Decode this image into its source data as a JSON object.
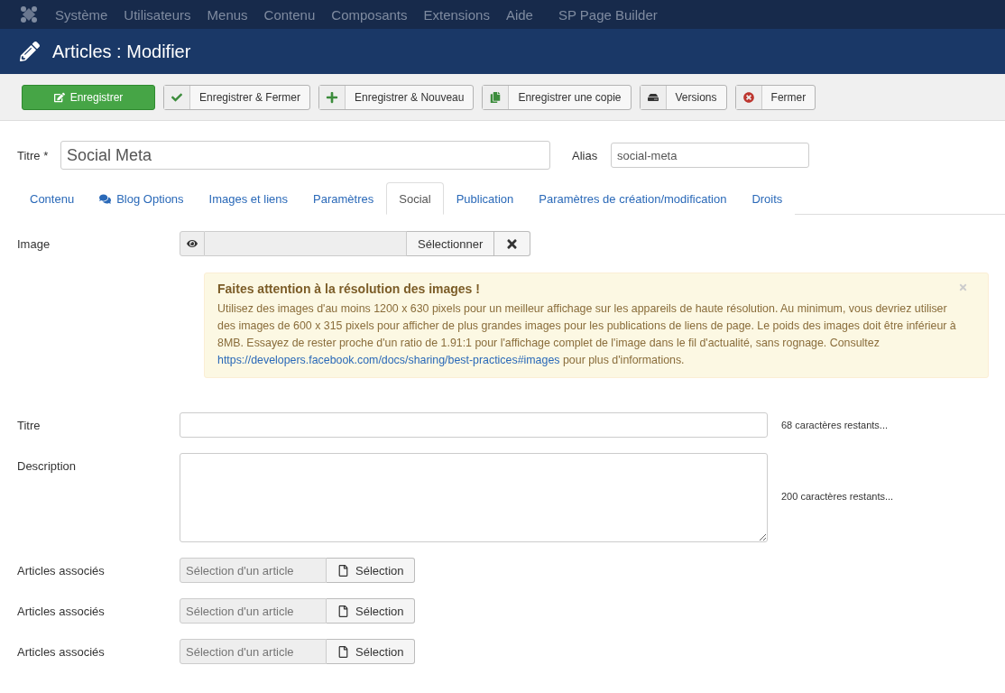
{
  "top_menu": {
    "items": [
      "Système",
      "Utilisateurs",
      "Menus",
      "Contenu",
      "Composants",
      "Extensions",
      "Aide",
      "SP Page Builder"
    ]
  },
  "header": {
    "title": "Articles : Modifier"
  },
  "toolbar": [
    {
      "label": "Enregistrer",
      "kind": "save"
    },
    {
      "label": "Enregistrer & Fermer",
      "kind": "check"
    },
    {
      "label": "Enregistrer & Nouveau",
      "kind": "plus"
    },
    {
      "label": "Enregistrer une copie",
      "kind": "copy"
    },
    {
      "label": "Versions",
      "kind": "versions"
    },
    {
      "label": "Fermer",
      "kind": "close"
    }
  ],
  "title_field": {
    "label": "Titre *",
    "value": "Social Meta"
  },
  "alias_field": {
    "label": "Alias",
    "value": "social-meta"
  },
  "tabs": [
    {
      "label": "Contenu",
      "selected": false
    },
    {
      "label": "Blog Options",
      "selected": false,
      "kind": "comments"
    },
    {
      "label": "Images et liens",
      "selected": false
    },
    {
      "label": "Paramètres",
      "selected": false
    },
    {
      "label": "Social",
      "selected": true
    },
    {
      "label": "Publication",
      "selected": false
    },
    {
      "label": "Paramètres de création/modification",
      "selected": false
    },
    {
      "label": "Droits",
      "selected": false
    }
  ],
  "image_field": {
    "label": "Image",
    "select_button": "Sélectionner"
  },
  "alert": {
    "title": "Faites attention à la résolution des images !",
    "text_before": "Utilisez des images d'au moins 1200 x 630 pixels pour un meilleur affichage sur les appareils de haute résolution. Au minimum, vous devriez utiliser des images de 600 x 315 pixels pour afficher de plus grandes images pour les publications de liens de page. Le poids des images doit être inférieur à 8MB. Essayez de rester proche d'un ratio de 1.91:1 pour l'affichage complet de l'image dans le fil d'actualité, sans rognage. Consultez",
    "link": "https://developers.facebook.com/docs/sharing/best-practices#images",
    "text_after": "pour plus d'informations."
  },
  "og_title": {
    "label": "Titre",
    "counter": "68 caractères restants..."
  },
  "og_description": {
    "label": "Description",
    "counter": "200 caractères restants..."
  },
  "related_articles": [
    {
      "label": "Articles associés",
      "placeholder": "Sélection d'un article",
      "button": "Sélection"
    },
    {
      "label": "Articles associés",
      "placeholder": "Sélection d'un article",
      "button": "Sélection"
    },
    {
      "label": "Articles associés",
      "placeholder": "Sélection d'un article",
      "button": "Sélection"
    }
  ]
}
